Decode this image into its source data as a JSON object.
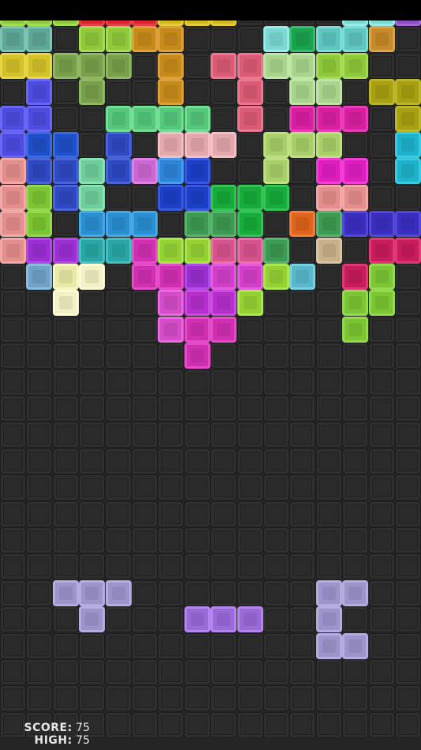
{
  "colors": {
    "background": "#252525",
    "empty_cell": "#2a2a2a",
    "top_bar": "#000000"
  },
  "grid": {
    "cols": 16,
    "rows": 28,
    "rows_text": [
      "RAABBBCCCDDDDEEF",
      "GG.HHII...JKLLM.",
      "NNOOO.I.PPQQRR..",
      ".S.O..I..P.QQ.TT",
      "UU..VVVV.P.WWW.T",
      "XYY.Z.aaa.bbb..c",
      "dZZeZfgh..b.ii.c",
      "jkZe..hhlll.jj..",
      "jk.mmm.nnl.onqqq",
      "jrr::*++,,n.s.tt",
      ".uvw.**&88+y.tk.",
      "..w...-%%+...kk.",
      "......-**....k..",
      ".......*........"
    ],
    "palette": {
      "R": {
        "fill": "#8fc93a",
        "edge": "#a4dc55"
      },
      "A": {
        "fill": "#8fc93a",
        "edge": "#a4dc55"
      },
      "B": {
        "fill": "#d6262e",
        "edge": "#e84048"
      },
      "C": {
        "fill": "#d4b820",
        "edge": "#e6cc38"
      },
      "D": {
        "fill": "#303030",
        "edge": "#303030"
      },
      "E": {
        "fill": "#7bd8d2",
        "edge": "#99ece6"
      },
      "F": {
        "fill": "#8c4dc0",
        "edge": "#a466d6"
      },
      "G": {
        "fill": "#5fa898",
        "edge": "#7cc4b4"
      },
      "H": {
        "fill": "#8fc93a",
        "edge": "#a4dc55"
      },
      "I": {
        "fill": "#c68a1a",
        "edge": "#dca13a"
      },
      "J": {
        "fill": "#7bd8d2",
        "edge": "#99ece6"
      },
      "K": {
        "fill": "#1aa34f",
        "edge": "#35bd6a"
      },
      "L": {
        "fill": "#5fc6bf",
        "edge": "#7cdcd6"
      },
      "M": {
        "fill": "#c68a2a",
        "edge": "#dca44a"
      },
      "N": {
        "fill": "#d4c22a",
        "edge": "#e6d648"
      },
      "O": {
        "fill": "#78a04a",
        "edge": "#90b862"
      },
      "P": {
        "fill": "#d95b74",
        "edge": "#ec7790"
      },
      "Q": {
        "fill": "#a9d48c",
        "edge": "#c0e6a6"
      },
      "S": {
        "fill": "#4d4be0",
        "edge": "#6866f2"
      },
      "T": {
        "fill": "#a6a012",
        "edge": "#bcb62c"
      },
      "U": {
        "fill": "#4d4be0",
        "edge": "#6866f2"
      },
      "V": {
        "fill": "#55c87c",
        "edge": "#72de96"
      },
      "W": {
        "fill": "#d81fa0",
        "edge": "#ea3cb8"
      },
      "X": {
        "fill": "#4d4be0",
        "edge": "#6866f2"
      },
      "Y": {
        "fill": "#1f4fc8",
        "edge": "#3a6ade"
      },
      "Z": {
        "fill": "#2f49c2",
        "edge": "#4a63d8"
      },
      "a": {
        "fill": "#e3a8ac",
        "edge": "#f2c0c4"
      },
      "b": {
        "fill": "#a9cf6a",
        "edge": "#bee082"
      },
      "c": {
        "fill": "#1eb3cc",
        "edge": "#3ccae0"
      },
      "d": {
        "fill": "#e58e8e",
        "edge": "#f3a8a8"
      },
      "e": {
        "fill": "#6fcf9c",
        "edge": "#8ae2b4"
      },
      "f": {
        "fill": "#cc66d2",
        "edge": "#df80e4"
      },
      "g": {
        "fill": "#2e84d8",
        "edge": "#4b9eee"
      },
      "h": {
        "fill": "#1c3fc8",
        "edge": "#3a5ade"
      },
      "i": {
        "fill": "#e01ec0",
        "edge": "#f03ed6"
      },
      "j": {
        "fill": "#e58e8e",
        "edge": "#f3a8a8"
      },
      "k": {
        "fill": "#7cc634",
        "edge": "#94da50"
      },
      "l": {
        "fill": "#17ab3a",
        "edge": "#34c456"
      },
      "m": {
        "fill": "#2a8fd0",
        "edge": "#48a8e6"
      },
      "n": {
        "fill": "#3d9a52",
        "edge": "#58b46c"
      },
      "o": {
        "fill": "#e0641c",
        "edge": "#f27e3a"
      },
      "q": {
        "fill": "#3a2ec0",
        "edge": "#5448d6"
      },
      "r": {
        "fill": "#9b2fd4",
        "edge": "#b24ae8"
      },
      "s": {
        "fill": "#c8b08a",
        "edge": "#dcc6a2"
      },
      "t": {
        "fill": "#c81c5c",
        "edge": "#de3a76"
      },
      "u": {
        "fill": "#6fa2c8",
        "edge": "#8abce0"
      },
      "v": {
        "fill": "#eaeaa8",
        "edge": "#f6f6c0"
      },
      "w": {
        "fill": "#f2f2c6",
        "edge": "#fbfbd8"
      },
      ":": {
        "fill": "#2aa6a6",
        "edge": "#44c0c0"
      },
      "*": {
        "fill": "#cf2fb0",
        "edge": "#e44cc8"
      },
      "+": {
        "fill": "#94d234",
        "edge": "#aae650"
      },
      ",": {
        "fill": "#d6548e",
        "edge": "#ea72a8"
      },
      "&": {
        "fill": "#9a2fcf",
        "edge": "#b24ae6"
      },
      "8": {
        "fill": "#d23fc8",
        "edge": "#e65cde"
      },
      "y": {
        "fill": "#5ab8cc",
        "edge": "#78d0e2"
      },
      "-": {
        "fill": "#d44cc8",
        "edge": "#e86ade"
      },
      "%": {
        "fill": "#b52fcc",
        "edge": "#cc4ce2"
      }
    }
  },
  "tray": {
    "pieces": [
      {
        "name": "piece-t-left",
        "color": "#9e94cc",
        "edge": "#b6acdf",
        "cells": [
          [
            0,
            0
          ],
          [
            1,
            0
          ],
          [
            2,
            0
          ],
          [
            1,
            1
          ]
        ],
        "origin": [
          2,
          22
        ]
      },
      {
        "name": "piece-line3",
        "color": "#9a6ad8",
        "edge": "#b286ec",
        "cells": [
          [
            0,
            0
          ],
          [
            1,
            0
          ],
          [
            2,
            0
          ]
        ],
        "origin": [
          7,
          23
        ]
      },
      {
        "name": "piece-c",
        "color": "#9e94cc",
        "edge": "#b6acdf",
        "cells": [
          [
            0,
            0
          ],
          [
            1,
            0
          ],
          [
            0,
            1
          ],
          [
            0,
            2
          ],
          [
            1,
            2
          ]
        ],
        "origin": [
          12,
          22
        ]
      }
    ]
  },
  "score": {
    "score_label": "SCORE:",
    "score_value": "75",
    "high_label": "HIGH:",
    "high_value": "75"
  }
}
